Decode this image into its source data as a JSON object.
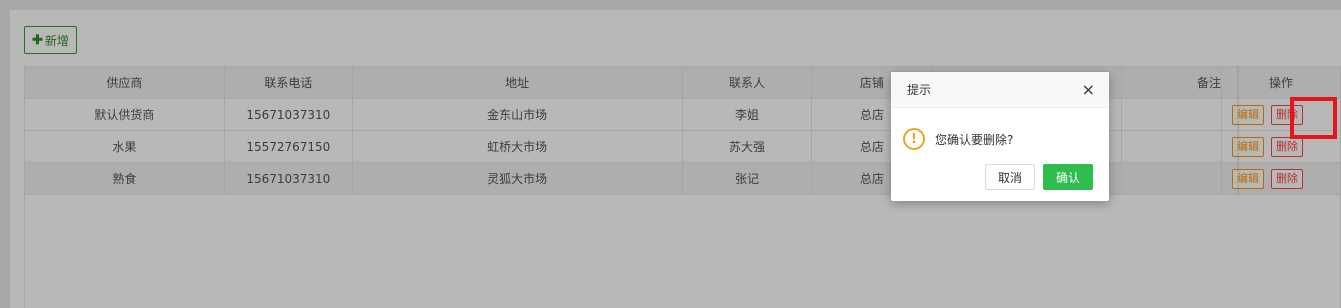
{
  "toolbar": {
    "add_label": "新增",
    "add_icon": "plus-icon"
  },
  "table": {
    "headers": [
      "供应商",
      "联系电话",
      "地址",
      "联系人",
      "店铺",
      "",
      "备注",
      "操作"
    ],
    "rows": [
      {
        "supplier": "默认供货商",
        "phone": "15671037310",
        "address": "金东山市场",
        "contact": "李姐",
        "store": "总店"
      },
      {
        "supplier": "水果",
        "phone": "15572767150",
        "address": "虹桥大市场",
        "contact": "苏大强",
        "store": "总店"
      },
      {
        "supplier": "熟食",
        "phone": "15671037310",
        "address": "灵狐大市场",
        "contact": "张记",
        "store": "总店"
      }
    ],
    "edit_label": "编辑",
    "delete_label": "删除"
  },
  "dialog": {
    "title": "提示",
    "close_icon": "×",
    "message": "您确认要删除?",
    "cancel_label": "取消",
    "ok_label": "确认",
    "warning_icon": "!"
  },
  "colors": {
    "primary_green": "#2fbd4e",
    "edit_orange": "#ff9800",
    "delete_red": "#ff4444",
    "highlight_red": "#e6141c"
  }
}
